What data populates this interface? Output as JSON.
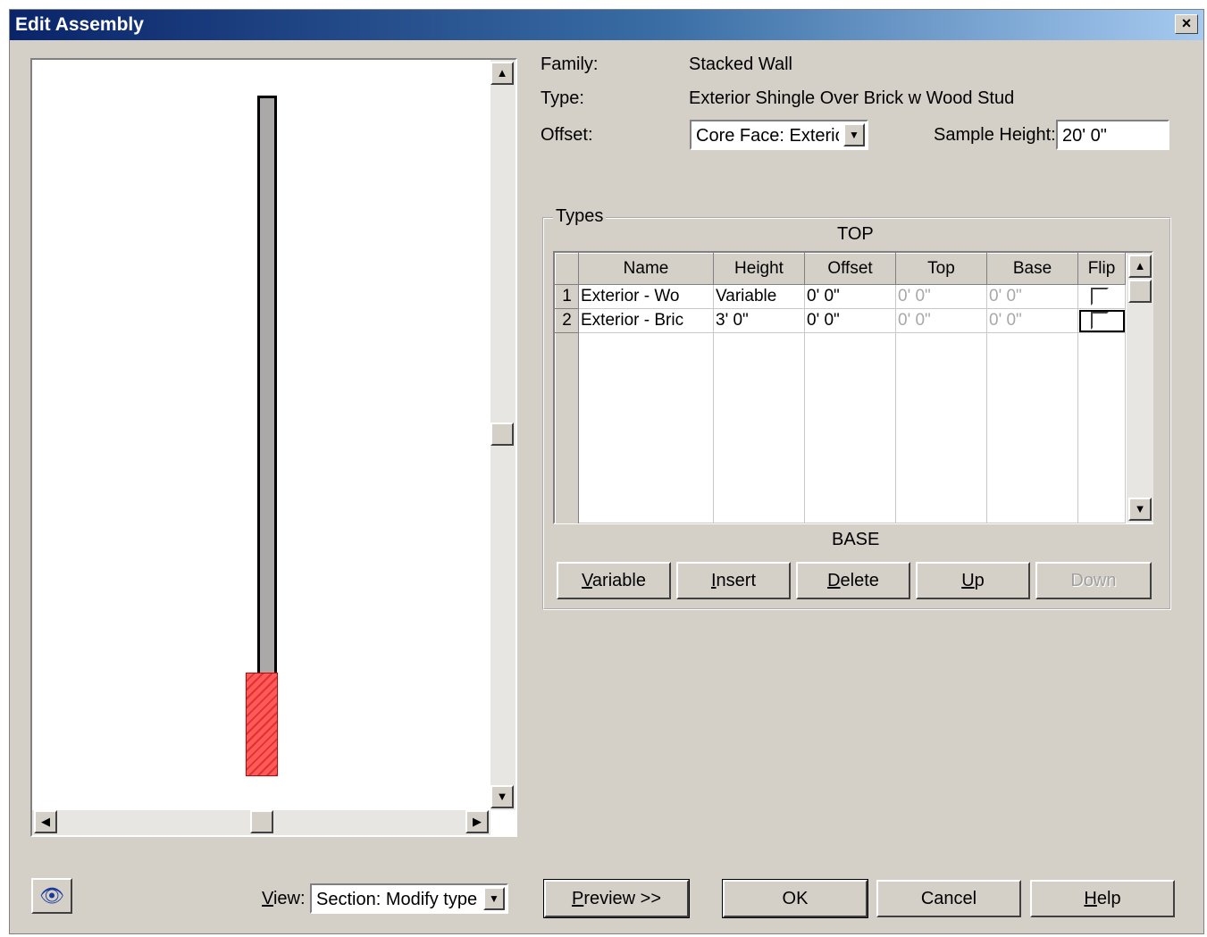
{
  "window": {
    "title": "Edit Assembly",
    "close_glyph": "×"
  },
  "properties": {
    "family_label": "Family:",
    "family_value": "Stacked Wall",
    "type_label": "Type:",
    "type_value": "Exterior Shingle Over Brick w Wood Stud",
    "offset_label": "Offset:",
    "offset_value": "Core Face: Exterior",
    "sample_height_label": "Sample Height:",
    "sample_height_value": "20'  0\""
  },
  "types_group": {
    "title": "Types",
    "top_label": "TOP",
    "base_label": "BASE",
    "columns": [
      "Name",
      "Height",
      "Offset",
      "Top",
      "Base",
      "Flip"
    ],
    "rows": [
      {
        "num": "1",
        "name": "Exterior - Wo",
        "height": "Variable",
        "offset": "0'  0\"",
        "top": "0'  0\"",
        "base": "0'  0\"",
        "flip": false
      },
      {
        "num": "2",
        "name": "Exterior - Bric",
        "height": "3'  0\"",
        "offset": "0'  0\"",
        "top": "0'  0\"",
        "base": "0'  0\"",
        "flip": false
      }
    ],
    "buttons": {
      "variable": {
        "mnemonic": "V",
        "rest": "ariable"
      },
      "insert": {
        "mnemonic": "I",
        "rest": "nsert"
      },
      "delete": {
        "mnemonic": "D",
        "rest": "elete"
      },
      "up": {
        "mnemonic": "U",
        "rest": "p"
      },
      "down": {
        "mnemonic": "",
        "rest": "Down"
      }
    }
  },
  "footer": {
    "view_label_mnemonic": "V",
    "view_label_rest": "iew:",
    "view_value": "Section: Modify type a",
    "preview": {
      "mnemonic": "P",
      "rest": "review >>"
    },
    "ok_label": "OK",
    "cancel_label": "Cancel",
    "help": {
      "mnemonic": "H",
      "rest": "elp"
    }
  },
  "colors": {
    "titlebar_start": "#0a246a",
    "dialog_bg": "#d4d0c8",
    "brick_layer": "#ff5a5a",
    "wood_layer": "#aaa9a7"
  }
}
